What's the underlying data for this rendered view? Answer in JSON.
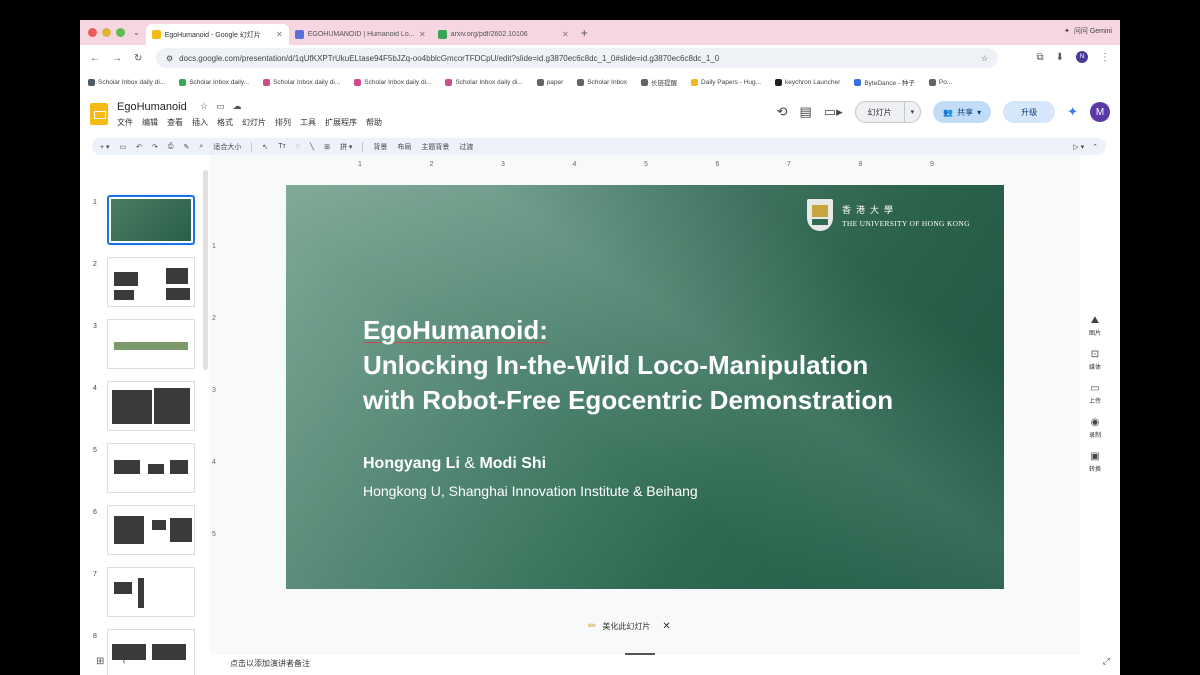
{
  "browser": {
    "tabs": [
      {
        "title": "EgoHumanoid - Google 幻灯片",
        "color": "#f5ba14",
        "active": true
      },
      {
        "title": "EGOHUMANOID | Humanoid Lo...",
        "color": "#5a6fd8",
        "active": false
      },
      {
        "title": "arxiv.org/pdf/2602.10106",
        "color": "#3aa457",
        "active": false
      }
    ],
    "new_tab_glyph": "+",
    "gemini_label": "问问 Gemini",
    "url": "docs.google.com/presentation/d/1qUfKXPTrUkuELtase94F5bJZq-oo4bblcGmcorTFDCpU/edit?slide=id.g3870ec6c8dc_1_0#slide=id.g3870ec6c8dc_1_0",
    "profile_initial": "N",
    "bookmarks": [
      {
        "label": "Scholar Inbox daily di...",
        "color": "#4f5b66"
      },
      {
        "label": "Scholar Inbox daily...",
        "color": "#3aa457"
      },
      {
        "label": "Scholar Inbox daily di...",
        "color": "#d14b8f"
      },
      {
        "label": "Scholar Inbox daily di...",
        "color": "#d14b8f"
      },
      {
        "label": "Scholar Inbox daily di...",
        "color": "#d14b8f"
      },
      {
        "label": "paper",
        "color": "#666666"
      },
      {
        "label": "Scholar Inbox",
        "color": "#666666"
      },
      {
        "label": "长链提醒",
        "color": "#666666"
      },
      {
        "label": "Daily Papers - Hug...",
        "color": "#f2b824"
      },
      {
        "label": "keychron Launcher",
        "color": "#222222"
      },
      {
        "label": "ByteDance - 种子",
        "color": "#3b6de0"
      },
      {
        "label": "Po...",
        "color": "#666666"
      }
    ]
  },
  "docs": {
    "title": "EgoHumanoid",
    "menu": [
      "文件",
      "编辑",
      "查看",
      "插入",
      "格式",
      "幻灯片",
      "排列",
      "工具",
      "扩展程序",
      "帮助"
    ],
    "slideshow_label": "幻灯片",
    "share_label": "共享",
    "upgrade_label": "升级",
    "user_initial": "M",
    "toolbar": {
      "zoom": "适合大小",
      "items": [
        "背景",
        "布局",
        "主题背景",
        "过渡"
      ]
    }
  },
  "filmstrip": {
    "numbers": [
      "1",
      "2",
      "3",
      "4",
      "5",
      "6",
      "7",
      "8"
    ],
    "selected_index": 0
  },
  "ruler": {
    "top": [
      "1",
      "2",
      "3",
      "4",
      "5",
      "6",
      "7",
      "8",
      "9"
    ],
    "left": [
      "1",
      "2",
      "3",
      "4",
      "5"
    ]
  },
  "slide": {
    "logo_cn": "香港大學",
    "logo_en": "THE UNIVERSITY OF HONG KONG",
    "title_line1": "EgoHumanoid:",
    "title_line2": "Unlocking In-the-Wild Loco-Manipulation",
    "title_line3": "with Robot-Free Egocentric Demonstration",
    "author1": "Hongyang Li",
    "author_sep": " & ",
    "author2": "Modi Shi",
    "affiliation": "Hongkong U, Shanghai Innovation Institute & Beihang",
    "bg_colors": [
      "#7fa897",
      "#1f5a45"
    ]
  },
  "beautify": {
    "label": "美化此幻灯片",
    "close": "✕"
  },
  "right_rail": [
    {
      "icon": "image-icon",
      "label": "图片"
    },
    {
      "icon": "tag-icon",
      "label": "媒体"
    },
    {
      "icon": "folder-icon",
      "label": "上传"
    },
    {
      "icon": "record-icon",
      "label": "录制"
    },
    {
      "icon": "transition-icon",
      "label": "转换"
    }
  ],
  "notes": {
    "placeholder": "点击以添加演讲者备注"
  }
}
